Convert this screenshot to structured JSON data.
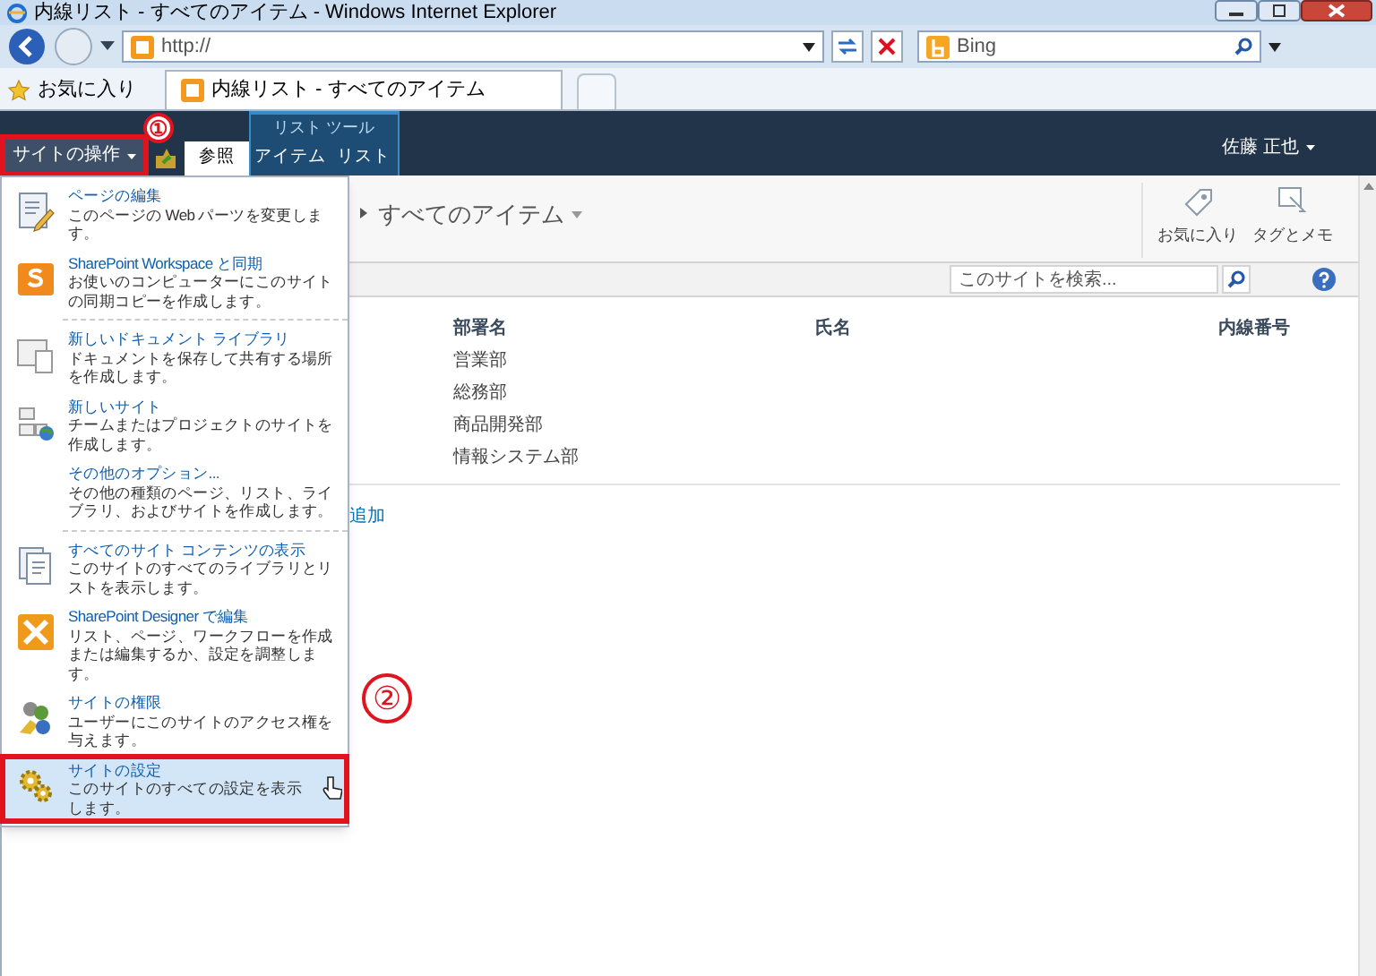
{
  "window": {
    "title": "内線リスト - すべてのアイテム - Windows Internet Explorer"
  },
  "address_bar": {
    "value": "http://"
  },
  "search_provider": {
    "name": "Bing"
  },
  "favorites_bar": {
    "favorites": "お気に入り",
    "tab": "内線リスト - すべてのアイテム"
  },
  "ribbon": {
    "site_actions": "サイトの操作",
    "tabs": [
      {
        "label": "参照",
        "selected": true
      },
      {
        "label": "アイテム",
        "selected": false
      },
      {
        "label": "リスト",
        "selected": false
      }
    ],
    "tool_group": "リスト ツール",
    "user": "佐藤 正也"
  },
  "page": {
    "view_title": "すべてのアイテム",
    "social": [
      {
        "label": "お気に入り"
      },
      {
        "label": "タグとメモ"
      }
    ],
    "search_placeholder": "このサイトを検索...",
    "add_link": "追加"
  },
  "table": {
    "columns": [
      "部署名",
      "氏名",
      "内線番号"
    ],
    "rows": [
      [
        "営業部"
      ],
      [
        "総務部"
      ],
      [
        "商品開発部"
      ],
      [
        "情報システム部"
      ]
    ]
  },
  "menu": {
    "groups": [
      [
        {
          "title": "ページの編集",
          "description": "このページの Web パーツを変更します。",
          "selected": false
        },
        {
          "title": "SharePoint Workspace と同期",
          "description": "お使いのコンピューターにこのサイトの同期コピーを作成します。",
          "selected": false
        }
      ],
      [
        {
          "title": "新しいドキュメント ライブラリ",
          "description": "ドキュメントを保存して共有する場所を作成します。",
          "selected": false
        },
        {
          "title": "新しいサイト",
          "description": "チームまたはプロジェクトのサイトを作成します。",
          "selected": false
        },
        {
          "title": "その他のオプション...",
          "description": "その他の種類のページ、リスト、ライブラリ、およびサイトを作成します。",
          "selected": false
        }
      ],
      [
        {
          "title": "すべてのサイト コンテンツの表示",
          "description": "このサイトのすべてのライブラリとリストを表示します。",
          "selected": false
        },
        {
          "title": "SharePoint Designer で編集",
          "description": "リスト、ページ、ワークフローを作成または編集するか、設定を調整します。",
          "selected": false
        },
        {
          "title": "サイトの権限",
          "description": "ユーザーにこのサイトのアクセス権を与えます。",
          "selected": false
        },
        {
          "title": "サイトの設定",
          "description": "このサイトのすべての設定を表示します。",
          "selected": true
        }
      ]
    ]
  },
  "annotations": [
    "①",
    "②"
  ]
}
